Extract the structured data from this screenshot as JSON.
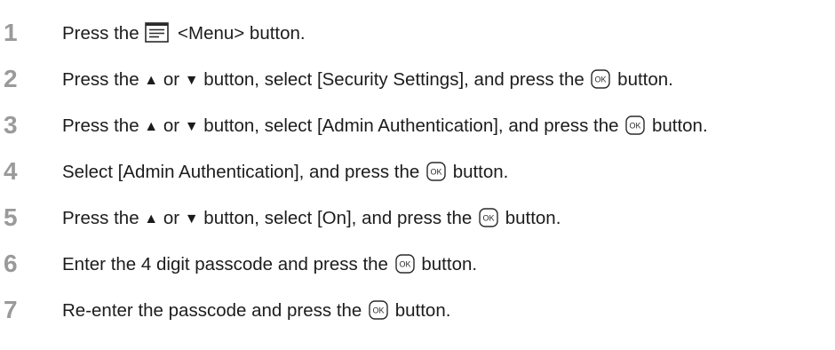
{
  "steps": [
    {
      "number": "1",
      "parts": [
        "Press the",
        "<Menu> button."
      ]
    },
    {
      "number": "2",
      "parts": [
        "Press the ",
        "▲",
        " or ",
        "▼",
        " button, select [Security Settings], and press the",
        "button."
      ]
    },
    {
      "number": "3",
      "parts": [
        "Press the ",
        "▲",
        " or ",
        "▼",
        " button, select [Admin Authentication], and press the",
        "button."
      ]
    },
    {
      "number": "4",
      "parts": [
        "Select [Admin Authentication], and press the",
        "button."
      ]
    },
    {
      "number": "5",
      "parts": [
        "Press the ",
        "▲",
        " or ",
        "▼",
        " button, select [On], and press the",
        "button."
      ]
    },
    {
      "number": "6",
      "parts": [
        "Enter the 4 digit passcode and press the",
        "button."
      ]
    },
    {
      "number": "7",
      "parts": [
        "Re-enter the passcode and press the",
        "button."
      ]
    }
  ],
  "icons": {
    "menu": "menu-button-icon",
    "ok": "ok-button-icon",
    "ok_label": "OK",
    "up": "up-arrow-icon",
    "down": "down-arrow-icon"
  },
  "colors": {
    "step_number": "#9a9a9a",
    "text": "#1c1c1c",
    "icon_stroke": "#2a2a2a"
  }
}
